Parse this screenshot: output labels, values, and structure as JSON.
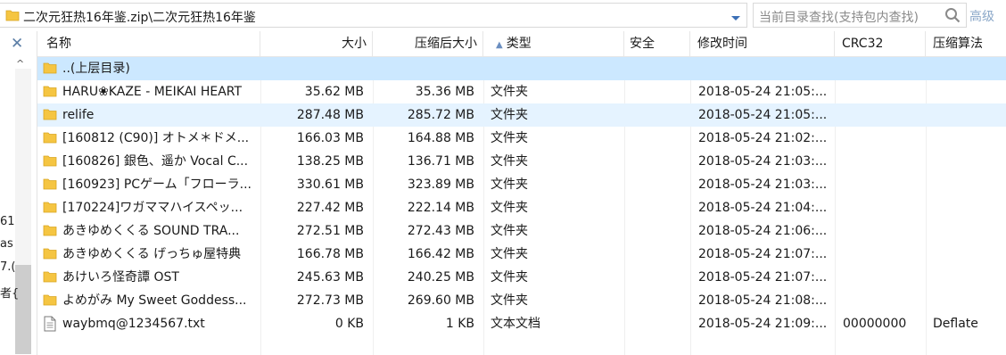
{
  "address": {
    "path": "二次元狂热16年鉴.zip\\二次元狂热16年鉴"
  },
  "search": {
    "placeholder": "当前目录查找(支持包内查找)",
    "advanced_label": "高级"
  },
  "left_strip": {
    "close_glyph": "✕",
    "up_glyph": "^",
    "fragments": [
      "61",
      "as",
      "7.(",
      "者{"
    ]
  },
  "columns": [
    {
      "key": "name",
      "label": "名称"
    },
    {
      "key": "size",
      "label": "大小"
    },
    {
      "key": "csize",
      "label": "压缩后大小"
    },
    {
      "key": "type",
      "label": "类型",
      "sorted": true
    },
    {
      "key": "security",
      "label": "安全"
    },
    {
      "key": "modified",
      "label": "修改时间"
    },
    {
      "key": "crc",
      "label": "CRC32"
    },
    {
      "key": "algo",
      "label": "压缩算法"
    }
  ],
  "rows": [
    {
      "icon": "folder-icon",
      "name": "..(上层目录)",
      "size": "",
      "csize": "",
      "type": "",
      "modified": "",
      "crc": "",
      "algo": "",
      "state": "sel"
    },
    {
      "icon": "folder-icon",
      "name": "HARU❀KAZE - MEIKAI HEART",
      "size": "35.62 MB",
      "csize": "35.36 MB",
      "type": "文件夹",
      "modified": "2018-05-24 21:05:...",
      "crc": "",
      "algo": "",
      "state": ""
    },
    {
      "icon": "folder-icon",
      "name": "relife",
      "size": "287.48 MB",
      "csize": "285.72 MB",
      "type": "文件夹",
      "modified": "2018-05-24 21:05:...",
      "crc": "",
      "algo": "",
      "state": "hover"
    },
    {
      "icon": "folder-icon",
      "name": "[160812 (C90)] オトメ＊ドメ...",
      "size": "166.03 MB",
      "csize": "164.88 MB",
      "type": "文件夹",
      "modified": "2018-05-24 21:02:...",
      "crc": "",
      "algo": "",
      "state": ""
    },
    {
      "icon": "folder-icon",
      "name": "[160826] 銀色、遥か Vocal C...",
      "size": "138.25 MB",
      "csize": "136.71 MB",
      "type": "文件夹",
      "modified": "2018-05-24 21:03:...",
      "crc": "",
      "algo": "",
      "state": ""
    },
    {
      "icon": "folder-icon",
      "name": "[160923] PCゲーム「フローラ...",
      "size": "330.61 MB",
      "csize": "323.89 MB",
      "type": "文件夹",
      "modified": "2018-05-24 21:03:...",
      "crc": "",
      "algo": "",
      "state": ""
    },
    {
      "icon": "folder-icon",
      "name": "[170224]ワガママハイスペッ...",
      "size": "227.42 MB",
      "csize": "222.14 MB",
      "type": "文件夹",
      "modified": "2018-05-24 21:04:...",
      "crc": "",
      "algo": "",
      "state": ""
    },
    {
      "icon": "folder-icon",
      "name": "あきゆめくくる SOUND TRA...",
      "size": "272.51 MB",
      "csize": "272.43 MB",
      "type": "文件夹",
      "modified": "2018-05-24 21:06:...",
      "crc": "",
      "algo": "",
      "state": ""
    },
    {
      "icon": "folder-icon",
      "name": "あきゆめくくる げっちゅ屋特典",
      "size": "166.78 MB",
      "csize": "166.42 MB",
      "type": "文件夹",
      "modified": "2018-05-24 21:07:...",
      "crc": "",
      "algo": "",
      "state": ""
    },
    {
      "icon": "folder-icon",
      "name": "あけいろ怪奇譚 OST",
      "size": "245.63 MB",
      "csize": "240.25 MB",
      "type": "文件夹",
      "modified": "2018-05-24 21:07:...",
      "crc": "",
      "algo": "",
      "state": ""
    },
    {
      "icon": "folder-icon",
      "name": "よめがみ My Sweet Goddess...",
      "size": "272.73 MB",
      "csize": "269.60 MB",
      "type": "文件夹",
      "modified": "2018-05-24 21:08:...",
      "crc": "",
      "algo": "",
      "state": ""
    },
    {
      "icon": "text-file-icon",
      "name": "waybmq@1234567.txt",
      "size": "0 KB",
      "csize": "1 KB",
      "type": "文本文档",
      "modified": "2018-05-24 21:09:...",
      "crc": "00000000",
      "algo": "Deflate",
      "state": ""
    }
  ],
  "colors": {
    "selected_row": "#cce8ff",
    "hover_row": "#e5f3ff",
    "folder": "#f5c542",
    "accent": "#5b7ea6"
  }
}
